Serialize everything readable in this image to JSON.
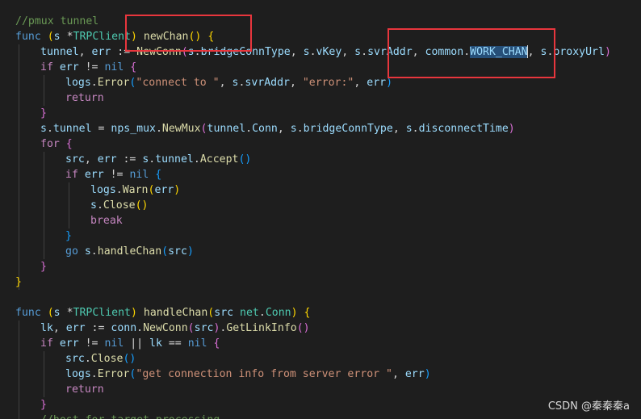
{
  "lines": [
    [
      [
        "cmt",
        "//pmux tunnel"
      ]
    ],
    [
      [
        "kw",
        "func"
      ],
      [
        "plain",
        " "
      ],
      [
        "br1",
        "("
      ],
      [
        "var",
        "s"
      ],
      [
        "plain",
        " *"
      ],
      [
        "type",
        "TRPClient"
      ],
      [
        "br1",
        ")"
      ],
      [
        "plain",
        " "
      ],
      [
        "fn",
        "newChan"
      ],
      [
        "br1",
        "()"
      ],
      [
        "plain",
        " "
      ],
      [
        "br1",
        "{"
      ]
    ],
    [
      [
        "var",
        "tunnel"
      ],
      [
        "plain",
        ", "
      ],
      [
        "var",
        "err"
      ],
      [
        "plain",
        " := "
      ],
      [
        "fn",
        "NewConn"
      ],
      [
        "br2",
        "("
      ],
      [
        "var",
        "s"
      ],
      [
        "plain",
        "."
      ],
      [
        "var",
        "bridgeConnType"
      ],
      [
        "plain",
        ", "
      ],
      [
        "var",
        "s"
      ],
      [
        "plain",
        "."
      ],
      [
        "var",
        "vKey"
      ],
      [
        "plain",
        ", "
      ],
      [
        "var",
        "s"
      ],
      [
        "plain",
        "."
      ],
      [
        "var",
        "svrAddr"
      ],
      [
        "plain",
        ", "
      ],
      [
        "var",
        "common"
      ],
      [
        "plain",
        "."
      ],
      [
        "var sel",
        "WORK_CHAN"
      ],
      [
        "cursor",
        ""
      ],
      [
        "plain",
        ", "
      ],
      [
        "var",
        "s"
      ],
      [
        "plain",
        "."
      ],
      [
        "var",
        "proxyUrl"
      ],
      [
        "br2",
        ")"
      ]
    ],
    [
      [
        "ctrl",
        "if"
      ],
      [
        "plain",
        " "
      ],
      [
        "var",
        "err"
      ],
      [
        "plain",
        " != "
      ],
      [
        "kw",
        "nil"
      ],
      [
        "plain",
        " "
      ],
      [
        "br2",
        "{"
      ]
    ],
    [
      [
        "var",
        "logs"
      ],
      [
        "plain",
        "."
      ],
      [
        "fn",
        "Error"
      ],
      [
        "br3",
        "("
      ],
      [
        "str",
        "\"connect to \""
      ],
      [
        "plain",
        ", "
      ],
      [
        "var",
        "s"
      ],
      [
        "plain",
        "."
      ],
      [
        "var",
        "svrAddr"
      ],
      [
        "plain",
        ", "
      ],
      [
        "str",
        "\"error:\""
      ],
      [
        "plain",
        ", "
      ],
      [
        "var",
        "err"
      ],
      [
        "br3",
        ")"
      ]
    ],
    [
      [
        "ctrl",
        "return"
      ]
    ],
    [
      [
        "br2",
        "}"
      ]
    ],
    [
      [
        "var",
        "s"
      ],
      [
        "plain",
        "."
      ],
      [
        "var",
        "tunnel"
      ],
      [
        "plain",
        " = "
      ],
      [
        "var",
        "nps_mux"
      ],
      [
        "plain",
        "."
      ],
      [
        "fn",
        "NewMux"
      ],
      [
        "br2",
        "("
      ],
      [
        "var",
        "tunnel"
      ],
      [
        "plain",
        "."
      ],
      [
        "var",
        "Conn"
      ],
      [
        "plain",
        ", "
      ],
      [
        "var",
        "s"
      ],
      [
        "plain",
        "."
      ],
      [
        "var",
        "bridgeConnType"
      ],
      [
        "plain",
        ", "
      ],
      [
        "var",
        "s"
      ],
      [
        "plain",
        "."
      ],
      [
        "var",
        "disconnectTime"
      ],
      [
        "br2",
        ")"
      ]
    ],
    [
      [
        "ctrl",
        "for"
      ],
      [
        "plain",
        " "
      ],
      [
        "br2",
        "{"
      ]
    ],
    [
      [
        "var",
        "src"
      ],
      [
        "plain",
        ", "
      ],
      [
        "var",
        "err"
      ],
      [
        "plain",
        " := "
      ],
      [
        "var",
        "s"
      ],
      [
        "plain",
        "."
      ],
      [
        "var",
        "tunnel"
      ],
      [
        "plain",
        "."
      ],
      [
        "fn",
        "Accept"
      ],
      [
        "br3",
        "()"
      ]
    ],
    [
      [
        "ctrl",
        "if"
      ],
      [
        "plain",
        " "
      ],
      [
        "var",
        "err"
      ],
      [
        "plain",
        " != "
      ],
      [
        "kw",
        "nil"
      ],
      [
        "plain",
        " "
      ],
      [
        "br3",
        "{"
      ]
    ],
    [
      [
        "var",
        "logs"
      ],
      [
        "plain",
        "."
      ],
      [
        "fn",
        "Warn"
      ],
      [
        "br1",
        "("
      ],
      [
        "var",
        "err"
      ],
      [
        "br1",
        ")"
      ]
    ],
    [
      [
        "var",
        "s"
      ],
      [
        "plain",
        "."
      ],
      [
        "fn",
        "Close"
      ],
      [
        "br1",
        "()"
      ]
    ],
    [
      [
        "ctrl",
        "break"
      ]
    ],
    [
      [
        "br3",
        "}"
      ]
    ],
    [
      [
        "kw",
        "go"
      ],
      [
        "plain",
        " "
      ],
      [
        "var",
        "s"
      ],
      [
        "plain",
        "."
      ],
      [
        "fn",
        "handleChan"
      ],
      [
        "br3",
        "("
      ],
      [
        "var",
        "src"
      ],
      [
        "br3",
        ")"
      ]
    ],
    [
      [
        "br2",
        "}"
      ]
    ],
    [
      [
        "br1",
        "}"
      ]
    ],
    [],
    [
      [
        "kw",
        "func"
      ],
      [
        "plain",
        " "
      ],
      [
        "br1",
        "("
      ],
      [
        "var",
        "s"
      ],
      [
        "plain",
        " *"
      ],
      [
        "type",
        "TRPClient"
      ],
      [
        "br1",
        ")"
      ],
      [
        "plain",
        " "
      ],
      [
        "fn",
        "handleChan"
      ],
      [
        "br1",
        "("
      ],
      [
        "var",
        "src"
      ],
      [
        "plain",
        " "
      ],
      [
        "type",
        "net"
      ],
      [
        "plain",
        "."
      ],
      [
        "type",
        "Conn"
      ],
      [
        "br1",
        ")"
      ],
      [
        "plain",
        " "
      ],
      [
        "br1",
        "{"
      ]
    ],
    [
      [
        "var",
        "lk"
      ],
      [
        "plain",
        ", "
      ],
      [
        "var",
        "err"
      ],
      [
        "plain",
        " := "
      ],
      [
        "var",
        "conn"
      ],
      [
        "plain",
        "."
      ],
      [
        "fn",
        "NewConn"
      ],
      [
        "br2",
        "("
      ],
      [
        "var",
        "src"
      ],
      [
        "br2",
        ")"
      ],
      [
        "plain",
        "."
      ],
      [
        "fn",
        "GetLinkInfo"
      ],
      [
        "br2",
        "()"
      ]
    ],
    [
      [
        "ctrl",
        "if"
      ],
      [
        "plain",
        " "
      ],
      [
        "var",
        "err"
      ],
      [
        "plain",
        " != "
      ],
      [
        "kw",
        "nil"
      ],
      [
        "plain",
        " || "
      ],
      [
        "var",
        "lk"
      ],
      [
        "plain",
        " == "
      ],
      [
        "kw",
        "nil"
      ],
      [
        "plain",
        " "
      ],
      [
        "br2",
        "{"
      ]
    ],
    [
      [
        "var",
        "src"
      ],
      [
        "plain",
        "."
      ],
      [
        "fn",
        "Close"
      ],
      [
        "br3",
        "()"
      ]
    ],
    [
      [
        "var",
        "logs"
      ],
      [
        "plain",
        "."
      ],
      [
        "fn",
        "Error"
      ],
      [
        "br3",
        "("
      ],
      [
        "str",
        "\"get connection info from server error \""
      ],
      [
        "plain",
        ", "
      ],
      [
        "var",
        "err"
      ],
      [
        "br3",
        ")"
      ]
    ],
    [
      [
        "ctrl",
        "return"
      ]
    ],
    [
      [
        "br2",
        "}"
      ]
    ],
    [
      [
        "cmt",
        "//host for target processing"
      ]
    ]
  ],
  "watermark": "CSDN @秦秦秦a"
}
